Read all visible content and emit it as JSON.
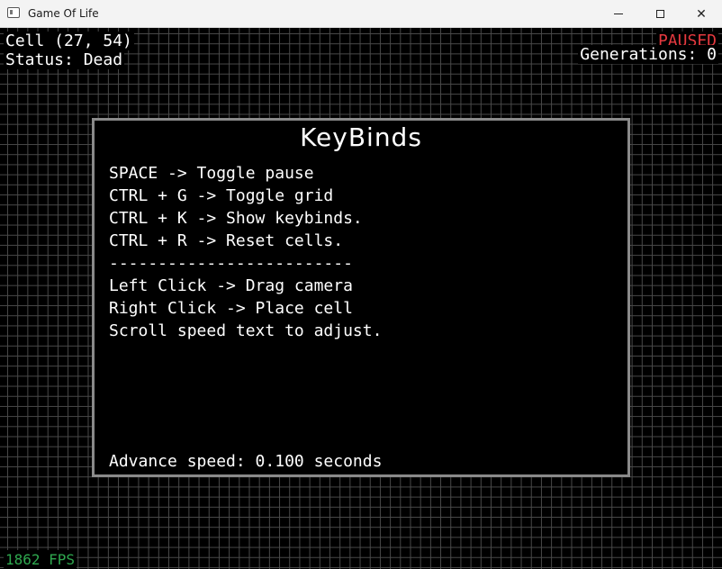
{
  "window": {
    "title": "Game Of Life",
    "icon": "app-window-icon",
    "buttons": {
      "minimize_icon": "minimize-icon",
      "maximize_icon": "maximize-icon",
      "close_icon": "close-icon",
      "close_glyph": "✕"
    }
  },
  "hud": {
    "cell": "Cell (27, 54)",
    "status": "Status: Dead",
    "paused": "PAUSED",
    "generations": "Generations: 0",
    "fps": "1862 FPS"
  },
  "keybinds": {
    "title": "KeyBinds",
    "lines": [
      "SPACE -> Toggle pause",
      "CTRL + G -> Toggle grid",
      "CTRL + K -> Show keybinds.",
      "CTRL + R -> Reset cells.",
      "-------------------------",
      "Left Click -> Drag camera",
      "Right Click -> Place cell",
      "Scroll speed text to adjust."
    ],
    "advance_speed": "Advance speed: 0.100 seconds"
  },
  "colors": {
    "background": "#000000",
    "grid_line": "#4a4a4a",
    "text": "#ffffff",
    "paused": "#e5393f",
    "fps": "#2fa84f",
    "panel_border": "#8a8a8a"
  }
}
